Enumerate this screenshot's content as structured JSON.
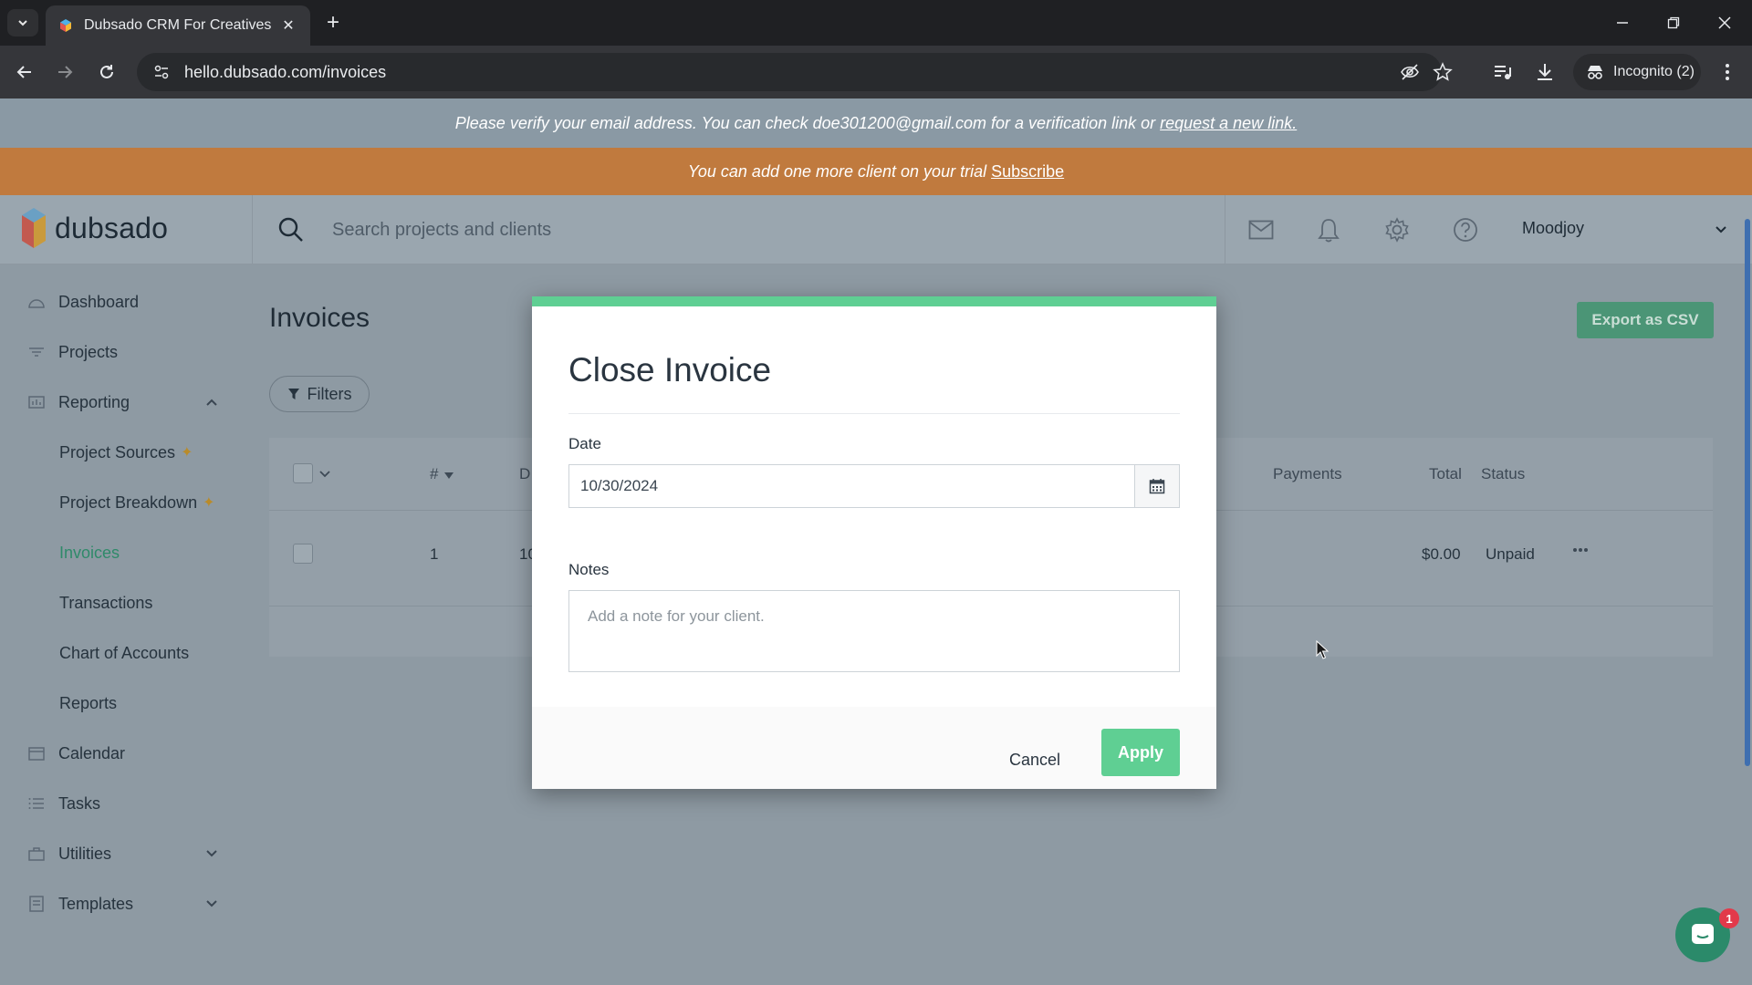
{
  "browser": {
    "tab_title": "Dubsado CRM For Creatives",
    "url": "hello.dubsado.com/invoices",
    "incognito_label": "Incognito (2)"
  },
  "banners": {
    "verify_text": "Please verify your email address. You can check doe301200@gmail.com for a verification link or",
    "verify_link": "request a new link.",
    "trial_text": "You can add one more client on your trial",
    "trial_link": "Subscribe"
  },
  "header": {
    "logo_text": "dubsado",
    "search_placeholder": "Search projects and clients",
    "user_name": "Moodjoy"
  },
  "sidebar": {
    "items": [
      {
        "label": "Dashboard"
      },
      {
        "label": "Projects"
      },
      {
        "label": "Reporting"
      },
      {
        "label": "Calendar"
      },
      {
        "label": "Tasks"
      },
      {
        "label": "Utilities"
      },
      {
        "label": "Templates"
      }
    ],
    "reporting_sub": [
      {
        "label": "Project Sources"
      },
      {
        "label": "Project Breakdown"
      },
      {
        "label": "Invoices"
      },
      {
        "label": "Transactions"
      },
      {
        "label": "Chart of Accounts"
      },
      {
        "label": "Reports"
      }
    ]
  },
  "main": {
    "title": "Invoices",
    "export_label": "Export as CSV",
    "filters_label": "Filters",
    "table": {
      "headers": [
        "#",
        "D",
        "Payments",
        "Total",
        "Status"
      ],
      "rows": [
        {
          "num": "1",
          "date_partial": "10",
          "total": "$0.00",
          "status": "Unpaid"
        }
      ]
    }
  },
  "modal": {
    "title": "Close Invoice",
    "date_label": "Date",
    "date_value": "10/30/2024",
    "notes_label": "Notes",
    "notes_placeholder": "Add a note for your client.",
    "cancel_label": "Cancel",
    "apply_label": "Apply"
  },
  "chat": {
    "badge_count": "1"
  },
  "colors": {
    "accent_green": "#5fcf93",
    "trial_orange": "#e8872a",
    "export_green": "#4b9576"
  }
}
